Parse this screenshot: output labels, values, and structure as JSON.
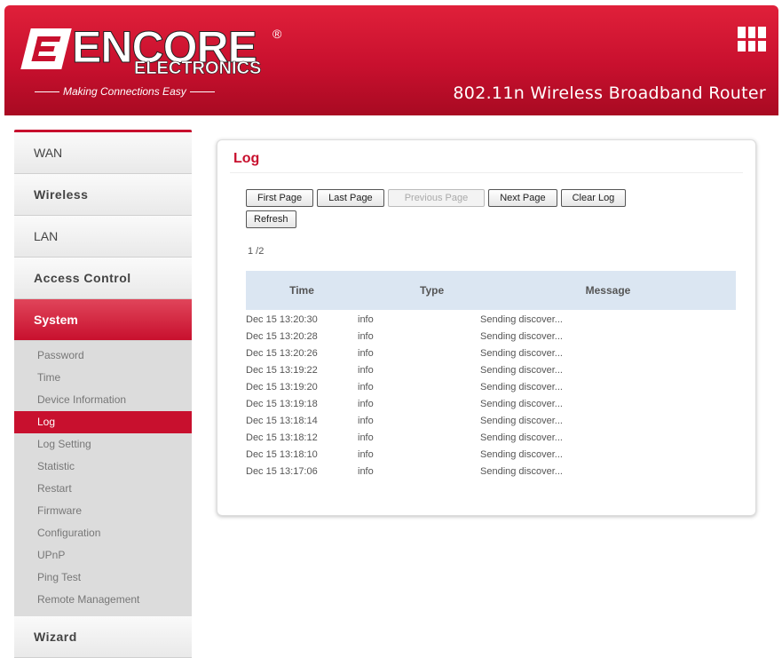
{
  "header": {
    "logo_word": "ENCORE",
    "logo_registered": "®",
    "logo_sub": "ELECTRONICS",
    "logo_tagline": "Making Connections Easy",
    "product_title": "802.11n Wireless Broadband Router",
    "accent_color": "#c8102e"
  },
  "sidebar": {
    "menu": [
      {
        "label": "WAN"
      },
      {
        "label": "Wireless"
      },
      {
        "label": "LAN"
      },
      {
        "label": "Access Control"
      },
      {
        "label": "System",
        "active": true
      }
    ],
    "system_items": [
      {
        "label": "Password"
      },
      {
        "label": "Time"
      },
      {
        "label": "Device Information"
      },
      {
        "label": "Log",
        "active": true
      },
      {
        "label": "Log Setting"
      },
      {
        "label": "Statistic"
      },
      {
        "label": "Restart"
      },
      {
        "label": "Firmware"
      },
      {
        "label": "Configuration"
      },
      {
        "label": "UPnP"
      },
      {
        "label": "Ping Test"
      },
      {
        "label": "Remote Management"
      }
    ],
    "wizard_label": "Wizard"
  },
  "main": {
    "title": "Log",
    "buttons": {
      "first_page": "First Page",
      "last_page": "Last Page",
      "previous_page": "Previous Page",
      "next_page": "Next Page",
      "clear_log": "Clear Log",
      "refresh": "Refresh"
    },
    "page_indicator": "1 /2",
    "table": {
      "headers": [
        "Time",
        "Type",
        "Message"
      ],
      "rows": [
        {
          "time": "Dec 15 13:20:30",
          "type": "info",
          "message": "Sending discover..."
        },
        {
          "time": "Dec 15 13:20:28",
          "type": "info",
          "message": "Sending discover..."
        },
        {
          "time": "Dec 15 13:20:26",
          "type": "info",
          "message": "Sending discover..."
        },
        {
          "time": "Dec 15 13:19:22",
          "type": "info",
          "message": "Sending discover..."
        },
        {
          "time": "Dec 15 13:19:20",
          "type": "info",
          "message": "Sending discover..."
        },
        {
          "time": "Dec 15 13:19:18",
          "type": "info",
          "message": "Sending discover..."
        },
        {
          "time": "Dec 15 13:18:14",
          "type": "info",
          "message": "Sending discover..."
        },
        {
          "time": "Dec 15 13:18:12",
          "type": "info",
          "message": "Sending discover..."
        },
        {
          "time": "Dec 15 13:18:10",
          "type": "info",
          "message": "Sending discover..."
        },
        {
          "time": "Dec 15 13:17:06",
          "type": "info",
          "message": "Sending discover..."
        }
      ]
    }
  }
}
